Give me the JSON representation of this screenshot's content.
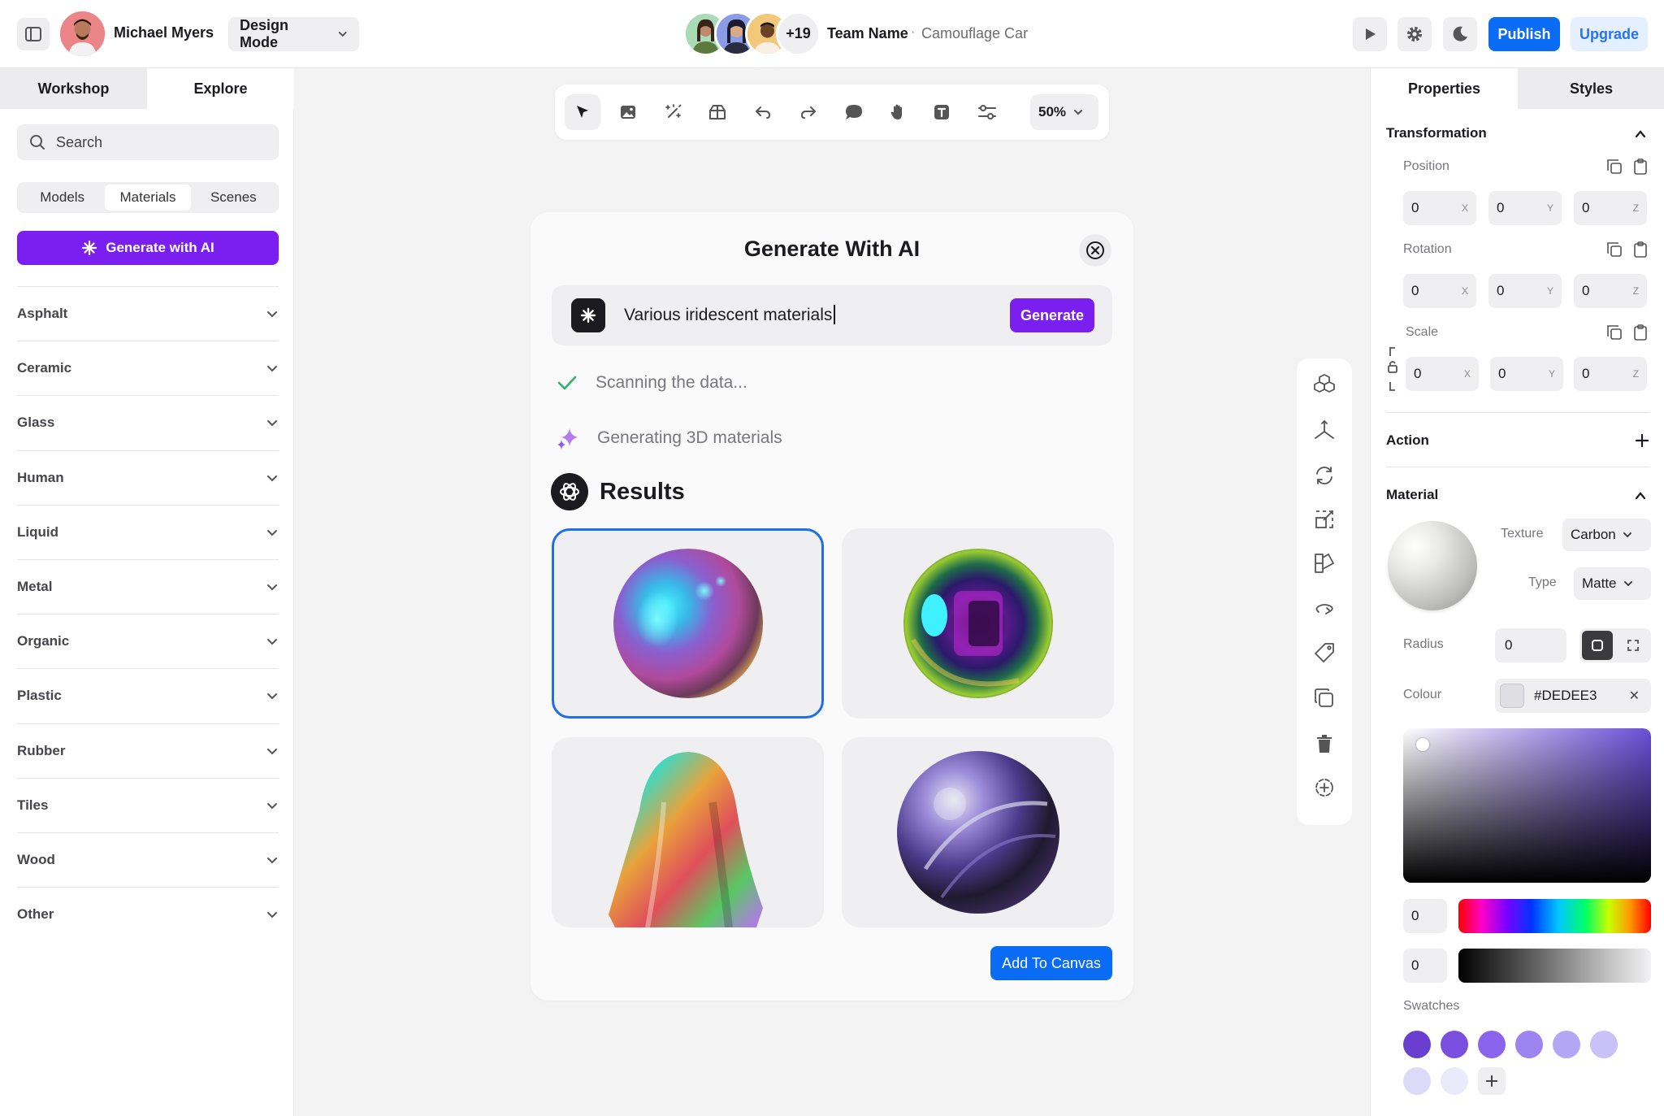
{
  "header": {
    "user_name": "Michael Myers",
    "mode": "Design Mode",
    "team_more_count": "+19",
    "team_name": "Team Name",
    "separator": "·",
    "project_name": "Camouflage Car",
    "publish_label": "Publish",
    "upgrade_label": "Upgrade",
    "icons": [
      "sidebar-toggle-icon",
      "play-icon",
      "gear-icon",
      "moon-icon"
    ]
  },
  "left_panel": {
    "tabs": [
      {
        "label": "Workshop",
        "active": false
      },
      {
        "label": "Explore",
        "active": true
      }
    ],
    "search_placeholder": "Search",
    "segments": [
      {
        "label": "Models",
        "active": false
      },
      {
        "label": "Materials",
        "active": true
      },
      {
        "label": "Scenes",
        "active": false
      }
    ],
    "generate_label": "Generate with AI",
    "categories": [
      "Asphalt",
      "Ceramic",
      "Glass",
      "Human",
      "Liquid",
      "Metal",
      "Organic",
      "Plastic",
      "Rubber",
      "Tiles",
      "Wood",
      "Other"
    ]
  },
  "toolbar": {
    "tools": [
      "select-icon",
      "image-icon",
      "magic-wand-icon",
      "box-icon",
      "undo-icon",
      "redo-icon",
      "comment-icon",
      "hand-icon",
      "text-icon",
      "sliders-icon"
    ],
    "zoom": "50%"
  },
  "modal": {
    "title": "Generate With AI",
    "prompt": "Various iridescent materials",
    "generate_label": "Generate",
    "steps": [
      {
        "text": "Scanning the data...",
        "status": "done"
      },
      {
        "text": "Generating 3D materials",
        "status": "in-progress"
      }
    ],
    "results_label": "Results",
    "results": [
      {
        "name": "iridescent-sphere-matte",
        "selected": true
      },
      {
        "name": "iridescent-sphere-chrome",
        "selected": false
      },
      {
        "name": "iridescent-cloth",
        "selected": false
      },
      {
        "name": "iridescent-sphere-foil",
        "selected": false
      }
    ],
    "add_label": "Add To Canvas"
  },
  "vertical_tools": [
    "cubes-icon",
    "axes-icon",
    "rotate-icon",
    "scale-icon",
    "shapes-icon",
    "orbit-icon",
    "tag-icon",
    "duplicate-icon",
    "trash-icon",
    "target-icon"
  ],
  "right_panel": {
    "tabs": [
      {
        "label": "Properties",
        "active": true
      },
      {
        "label": "Styles",
        "active": false
      }
    ],
    "transformation": {
      "title": "Transformation",
      "position": {
        "label": "Position",
        "x": "0",
        "y": "0",
        "z": "0"
      },
      "rotation": {
        "label": "Rotation",
        "x": "0",
        "y": "0",
        "z": "0"
      },
      "scale": {
        "label": "Scale",
        "x": "0",
        "y": "0",
        "z": "0"
      },
      "axis_labels": {
        "x": "X",
        "y": "Y",
        "z": "Z"
      }
    },
    "action": {
      "title": "Action"
    },
    "material": {
      "title": "Material",
      "texture_label": "Texture",
      "texture_value": "Carbon",
      "type_label": "Type",
      "type_value": "Matte",
      "radius_label": "Radius",
      "radius_value": "0",
      "colour_label": "Colour",
      "colour_value": "#DEDEE3",
      "hue_value": "0",
      "alpha_value": "0",
      "swatches_label": "Swatches",
      "swatches": [
        "#6a3fd0",
        "#7a4fe0",
        "#8a64ec",
        "#9d84f0",
        "#b3a6f4",
        "#c8c2f8",
        "#dcdaf9",
        "#ebeafb"
      ]
    }
  },
  "colors": {
    "accent_purple": "#7a1ff0",
    "accent_blue": "#0a6cf5",
    "selected_border": "#1f6fe8"
  }
}
